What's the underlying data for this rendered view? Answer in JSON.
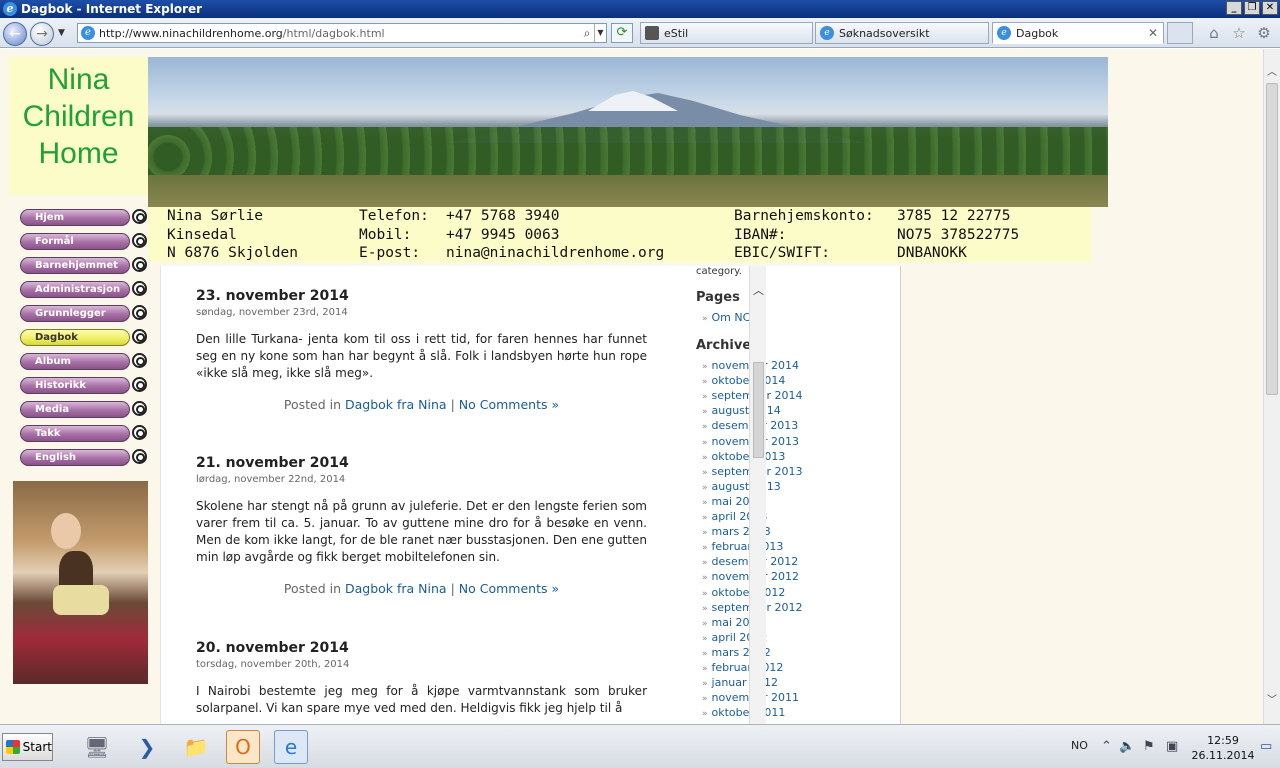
{
  "window": {
    "title": "Dagbok - Internet Explorer"
  },
  "browser": {
    "address_host": "http://www.ninachildrenhome.org",
    "address_path": "/html/dagbok.html",
    "tabs": [
      {
        "label": "eStil"
      },
      {
        "label": "Søknadsoversikt"
      },
      {
        "label": "Dagbok"
      }
    ]
  },
  "site": {
    "logo_line1": "Nina",
    "logo_line2": "Children",
    "logo_line3": "Home",
    "info": {
      "name": "Nina Sørlie",
      "place": "Kinsedal",
      "postal": "N 6876 Skjolden",
      "phone_label": "Telefon:",
      "phone": "+47 5768 3940",
      "mobile_label": "Mobil:",
      "mobile": "+47 9945 0063",
      "email_label": "E-post:",
      "email": "nina@ninachildrenhome.org",
      "account_label": "Barnehjemskonto:",
      "account": "3785 12 22775",
      "iban_label": "IBAN#:",
      "iban": "NO75 378522775",
      "swift_label": "EBIC/SWIFT:",
      "swift": "DNBANOKK"
    },
    "menu": [
      "Hjem",
      "Formål",
      "Barnehjemmet",
      "Administrasjon",
      "Grunnlegger",
      "Dagbok",
      "Album",
      "Historikk",
      "Media",
      "Takk",
      "English"
    ]
  },
  "posts": [
    {
      "title": "23. november 2014",
      "date": "søndag, november 23rd, 2014",
      "body": "Den lille Turkana- jenta kom til oss i rett tid, for faren hennes har funnet seg en ny kone som han har begynt å slå. Folk i landsbyen hørte hun rope «ikke slå meg, ikke slå meg».",
      "posted_in": "Posted in",
      "category": "Dagbok fra Nina",
      "sep": "|",
      "comments": "No Comments »"
    },
    {
      "title": "21. november 2014",
      "date": "lørdag, november 22nd, 2014",
      "body": "Skolene har stengt nå på grunn av juleferie. Det er den lengste ferien som varer frem til ca. 5. januar. To av guttene mine dro for å besøke en venn. Men de kom ikke langt, for de ble ranet nær busstasjonen. Den ene gutten min løp avgårde og fikk berget mobiltelefonen sin.",
      "posted_in": "Posted in",
      "category": "Dagbok fra Nina",
      "sep": "|",
      "comments": "No Comments »"
    },
    {
      "title": "20. november 2014",
      "date": "torsdag, november 20th, 2014",
      "body": "I Nairobi bestemte jeg meg for å kjøpe varmtvannstank som bruker solarpanel. Vi kan spare mye ved med den. Heldigvis fikk jeg hjelp til å"
    }
  ],
  "sidebar": {
    "category_text": "category.",
    "pages_title": "Pages",
    "pages": [
      "Om NCH"
    ],
    "archives_title": "Archives",
    "archives": [
      "november 2014",
      "oktober 2014",
      "september 2014",
      "august 2014",
      "desember 2013",
      "november 2013",
      "oktober 2013",
      "september 2013",
      "august 2013",
      "mai 2013",
      "april 2013",
      "mars 2013",
      "februar 2013",
      "desember 2012",
      "november 2012",
      "oktober 2012",
      "september 2012",
      "mai 2012",
      "april 2012",
      "mars 2012",
      "februar 2012",
      "januar 2012",
      "november 2011",
      "oktober 2011"
    ]
  },
  "taskbar": {
    "start_label": "Start",
    "language": "NO",
    "time": "12:59",
    "date": "26.11.2014"
  }
}
